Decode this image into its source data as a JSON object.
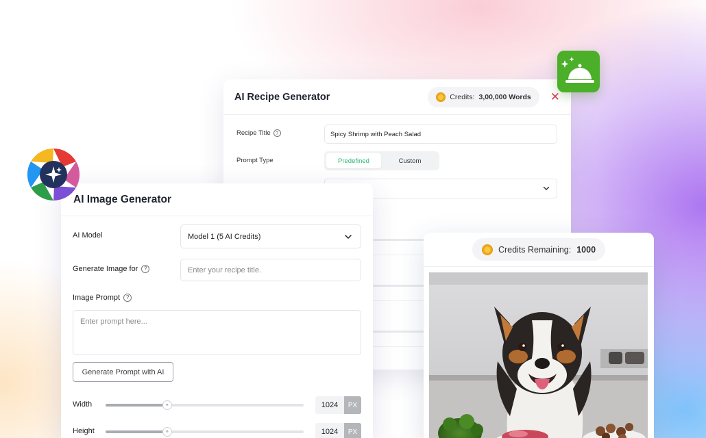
{
  "recipe_card": {
    "title": "AI Recipe Generator",
    "credits_label": "Credits:",
    "credits_value": "3,00,000 Words",
    "close_icon": "close-icon",
    "recipe_title_label": "Recipe Title",
    "recipe_title_value": "Spicy Shrimp with Peach Salad",
    "prompt_type_label": "Prompt Type",
    "prompt_type_options": [
      "Predefined",
      "Custom"
    ],
    "prompt_type_selected": "Predefined"
  },
  "image_card": {
    "title": "AI Image Generator",
    "ai_model_label": "AI Model",
    "ai_model_value": "Model 1 (5 AI Credits)",
    "generate_for_label": "Generate Image for",
    "generate_for_placeholder": "Enter your recipe title.",
    "image_prompt_label": "Image Prompt",
    "image_prompt_placeholder": "Enter prompt here...",
    "generate_prompt_button": "Generate Prompt with AI",
    "width_label": "Width",
    "width_value": "1024",
    "height_label": "Height",
    "height_value": "1024",
    "unit": "PX",
    "slider_level": 0.31
  },
  "photo_card": {
    "credits_label": "Credits Remaining:",
    "credits_value": "1000"
  },
  "colors": {
    "accent_green": "#2bb673",
    "close_red": "#e53b50",
    "badge_green": "#4caf2a"
  }
}
